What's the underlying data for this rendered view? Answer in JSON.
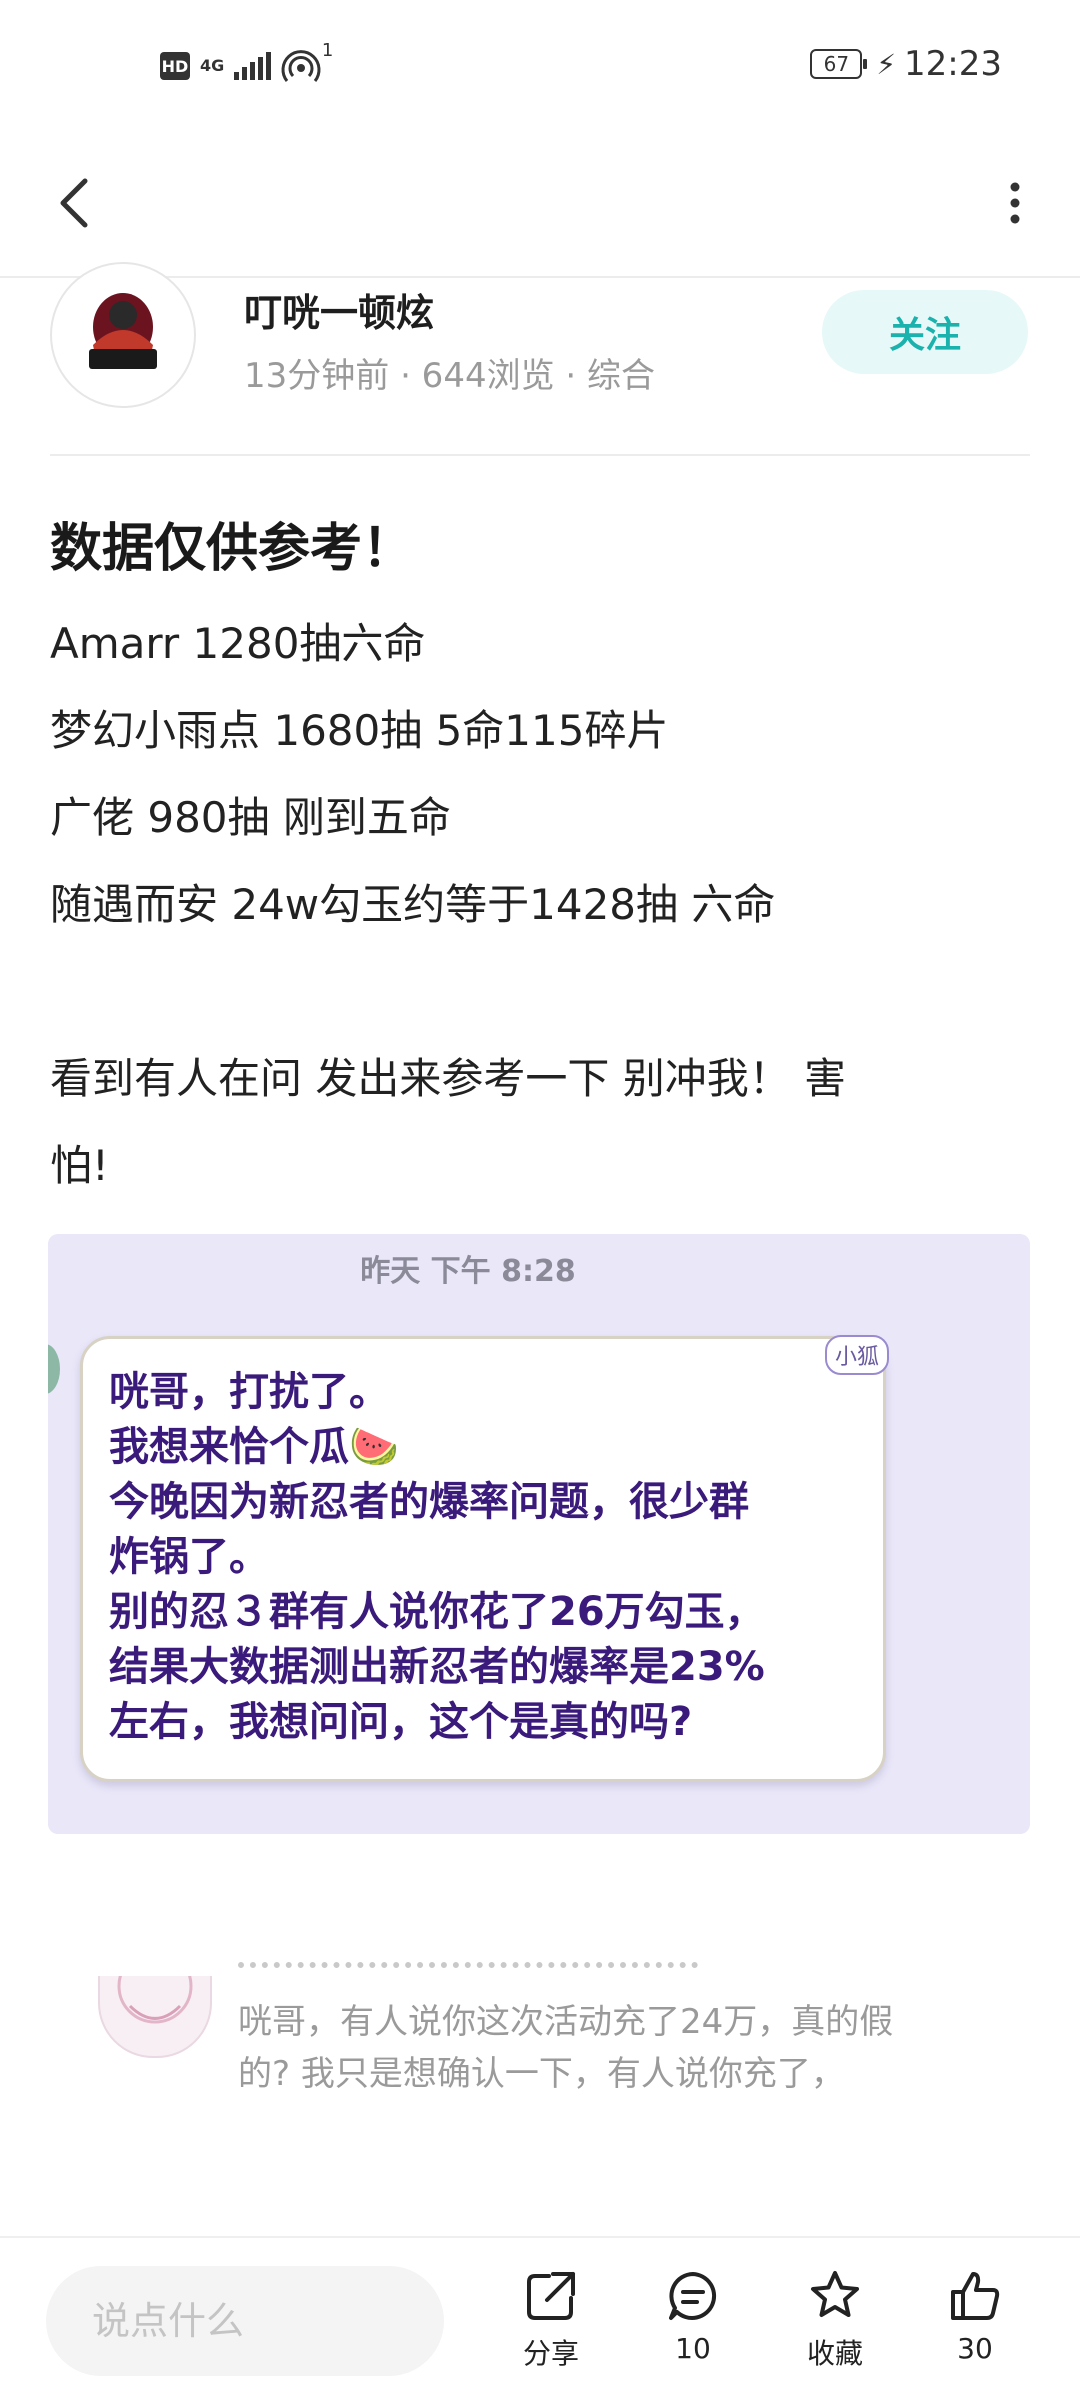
{
  "status_bar": {
    "hd": "HD",
    "network": "4G",
    "hotspot_count": "1",
    "battery": "67",
    "time": "12:23"
  },
  "author": {
    "name": "叮咣一顿炫",
    "meta": "13分钟前 · 644浏览 · 综合",
    "follow_label": "关注"
  },
  "post": {
    "title": "数据仅供参考！",
    "lines": [
      "Amarr 1280抽六命",
      "梦幻小雨点 1680抽 5命115碎片",
      "广佬 980抽 刚到五命",
      "随遇而安 24w勾玉约等于1428抽 六命",
      "",
      "看到有人在问 发出来参考一下 别冲我！ 害",
      "怕!"
    ]
  },
  "screenshot": {
    "time": "昨天 下午 8:28",
    "tag": "小狐",
    "lines": [
      "咣哥，打扰了。",
      "我想来恰个瓜🍉",
      "今晚因为新忍者的爆率问题，很少群",
      "炸锅了。",
      "别的忍３群有人说你花了26万勾玉，",
      "结果大数据测出新忍者的爆率是23%",
      "左右，我想问问，这个是真的吗?"
    ]
  },
  "preview": {
    "lines": [
      "咣哥，有人说你这次活动充了24万，真的假",
      "的? 我只是想确认一下，有人说你充了，"
    ]
  },
  "bottom_bar": {
    "input_placeholder": "说点什么",
    "share_label": "分享",
    "comment_count": "10",
    "collect_label": "收藏",
    "like_count": "30"
  },
  "colors": {
    "accent": "#1bb2ad",
    "follow_bg": "#e7f8f8",
    "card_bg": "#e9e7f8",
    "bubble_text": "#3a1a7a"
  },
  "icons": [
    "back-arrow-icon",
    "more-icon",
    "share-icon",
    "comment-icon",
    "star-icon",
    "thumb-up-icon"
  ]
}
